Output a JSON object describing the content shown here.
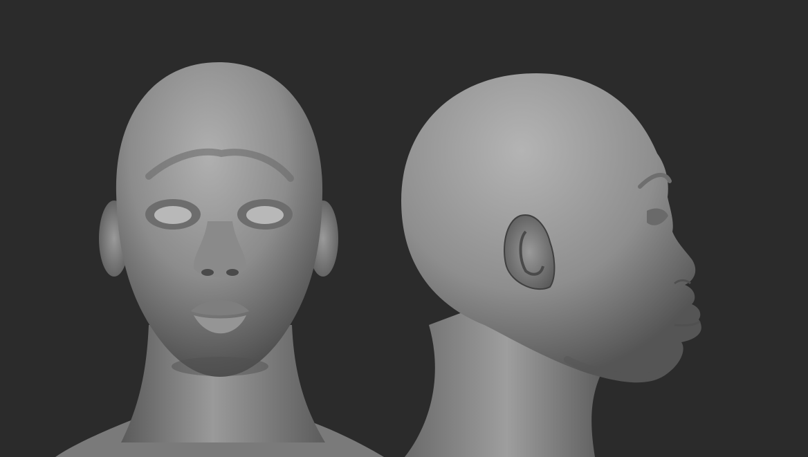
{
  "scene": {
    "background_color": "#2b2b2b",
    "clay_highlight": "#a8a8a8",
    "clay_mid": "#8a8a8a",
    "clay_shadow": "#4a4a4a",
    "views": [
      {
        "name": "front-view",
        "description_icon": "head-front-icon"
      },
      {
        "name": "side-view",
        "description_icon": "head-profile-icon"
      }
    ]
  }
}
